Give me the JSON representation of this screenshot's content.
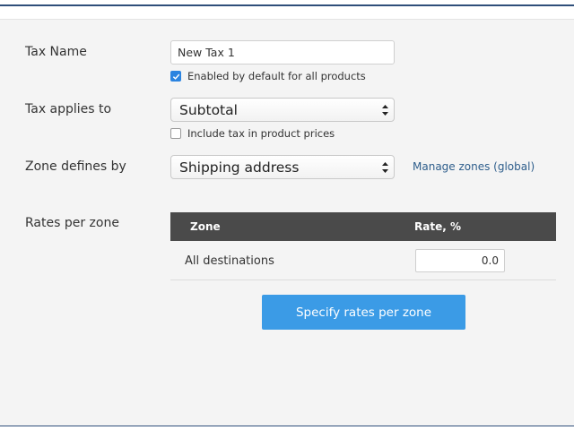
{
  "colors": {
    "accent": "#3b9be6",
    "checkbox_checked": "#2b84e0",
    "table_header": "#4a4a4a",
    "link": "#2d5d8b",
    "panel_bg": "#f4f4f4",
    "border_line": "#2f4f7a"
  },
  "form": {
    "tax_name": {
      "label": "Tax Name",
      "value": "New Tax 1",
      "enabled_default": {
        "checked": true,
        "label": "Enabled by default for all products"
      }
    },
    "tax_applies_to": {
      "label": "Tax applies to",
      "selected": "Subtotal",
      "include_tax": {
        "checked": false,
        "label": "Include tax in product prices"
      }
    },
    "zone_defines_by": {
      "label": "Zone defines by",
      "selected": "Shipping address",
      "manage_link": "Manage zones (global)"
    },
    "rates_per_zone": {
      "label": "Rates per zone",
      "columns": [
        "Zone",
        "Rate, %"
      ],
      "rows": [
        {
          "zone": "All destinations",
          "rate": "0.0"
        }
      ],
      "button_label": "Specify rates per zone"
    }
  }
}
